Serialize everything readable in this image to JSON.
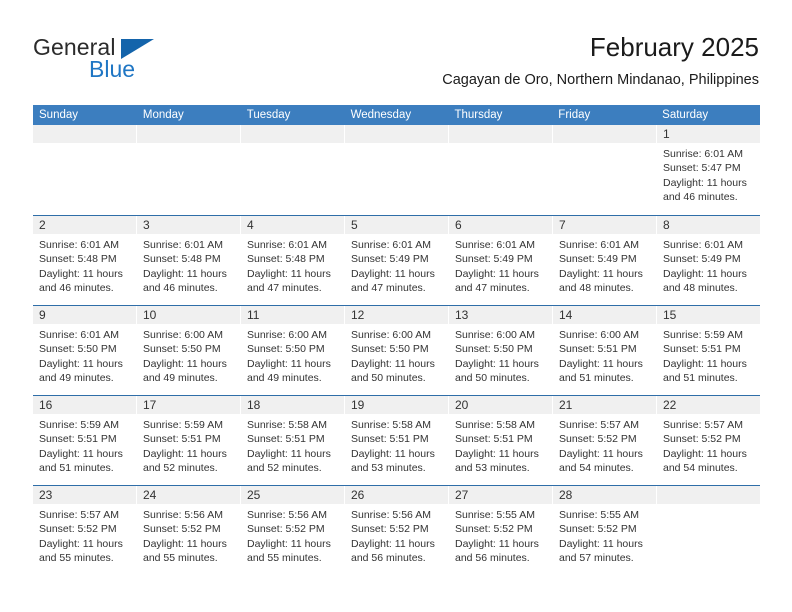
{
  "brand": {
    "name_part1": "General",
    "name_part2": "Blue",
    "accent_color": "#1f76c4",
    "triangle_color": "#1464ab"
  },
  "header": {
    "title": "February 2025",
    "subtitle": "Cagayan de Oro, Northern Mindanao, Philippines"
  },
  "calendar": {
    "header_bg": "#3c7ebf",
    "weekdays": [
      "Sunday",
      "Monday",
      "Tuesday",
      "Wednesday",
      "Thursday",
      "Friday",
      "Saturday"
    ],
    "weeks": [
      [
        {
          "date": "",
          "sunrise": "",
          "sunset": "",
          "daylight_line1": "",
          "daylight_line2": ""
        },
        {
          "date": "",
          "sunrise": "",
          "sunset": "",
          "daylight_line1": "",
          "daylight_line2": ""
        },
        {
          "date": "",
          "sunrise": "",
          "sunset": "",
          "daylight_line1": "",
          "daylight_line2": ""
        },
        {
          "date": "",
          "sunrise": "",
          "sunset": "",
          "daylight_line1": "",
          "daylight_line2": ""
        },
        {
          "date": "",
          "sunrise": "",
          "sunset": "",
          "daylight_line1": "",
          "daylight_line2": ""
        },
        {
          "date": "",
          "sunrise": "",
          "sunset": "",
          "daylight_line1": "",
          "daylight_line2": ""
        },
        {
          "date": "1",
          "sunrise": "Sunrise: 6:01 AM",
          "sunset": "Sunset: 5:47 PM",
          "daylight_line1": "Daylight: 11 hours",
          "daylight_line2": "and 46 minutes."
        }
      ],
      [
        {
          "date": "2",
          "sunrise": "Sunrise: 6:01 AM",
          "sunset": "Sunset: 5:48 PM",
          "daylight_line1": "Daylight: 11 hours",
          "daylight_line2": "and 46 minutes."
        },
        {
          "date": "3",
          "sunrise": "Sunrise: 6:01 AM",
          "sunset": "Sunset: 5:48 PM",
          "daylight_line1": "Daylight: 11 hours",
          "daylight_line2": "and 46 minutes."
        },
        {
          "date": "4",
          "sunrise": "Sunrise: 6:01 AM",
          "sunset": "Sunset: 5:48 PM",
          "daylight_line1": "Daylight: 11 hours",
          "daylight_line2": "and 47 minutes."
        },
        {
          "date": "5",
          "sunrise": "Sunrise: 6:01 AM",
          "sunset": "Sunset: 5:49 PM",
          "daylight_line1": "Daylight: 11 hours",
          "daylight_line2": "and 47 minutes."
        },
        {
          "date": "6",
          "sunrise": "Sunrise: 6:01 AM",
          "sunset": "Sunset: 5:49 PM",
          "daylight_line1": "Daylight: 11 hours",
          "daylight_line2": "and 47 minutes."
        },
        {
          "date": "7",
          "sunrise": "Sunrise: 6:01 AM",
          "sunset": "Sunset: 5:49 PM",
          "daylight_line1": "Daylight: 11 hours",
          "daylight_line2": "and 48 minutes."
        },
        {
          "date": "8",
          "sunrise": "Sunrise: 6:01 AM",
          "sunset": "Sunset: 5:49 PM",
          "daylight_line1": "Daylight: 11 hours",
          "daylight_line2": "and 48 minutes."
        }
      ],
      [
        {
          "date": "9",
          "sunrise": "Sunrise: 6:01 AM",
          "sunset": "Sunset: 5:50 PM",
          "daylight_line1": "Daylight: 11 hours",
          "daylight_line2": "and 49 minutes."
        },
        {
          "date": "10",
          "sunrise": "Sunrise: 6:00 AM",
          "sunset": "Sunset: 5:50 PM",
          "daylight_line1": "Daylight: 11 hours",
          "daylight_line2": "and 49 minutes."
        },
        {
          "date": "11",
          "sunrise": "Sunrise: 6:00 AM",
          "sunset": "Sunset: 5:50 PM",
          "daylight_line1": "Daylight: 11 hours",
          "daylight_line2": "and 49 minutes."
        },
        {
          "date": "12",
          "sunrise": "Sunrise: 6:00 AM",
          "sunset": "Sunset: 5:50 PM",
          "daylight_line1": "Daylight: 11 hours",
          "daylight_line2": "and 50 minutes."
        },
        {
          "date": "13",
          "sunrise": "Sunrise: 6:00 AM",
          "sunset": "Sunset: 5:50 PM",
          "daylight_line1": "Daylight: 11 hours",
          "daylight_line2": "and 50 minutes."
        },
        {
          "date": "14",
          "sunrise": "Sunrise: 6:00 AM",
          "sunset": "Sunset: 5:51 PM",
          "daylight_line1": "Daylight: 11 hours",
          "daylight_line2": "and 51 minutes."
        },
        {
          "date": "15",
          "sunrise": "Sunrise: 5:59 AM",
          "sunset": "Sunset: 5:51 PM",
          "daylight_line1": "Daylight: 11 hours",
          "daylight_line2": "and 51 minutes."
        }
      ],
      [
        {
          "date": "16",
          "sunrise": "Sunrise: 5:59 AM",
          "sunset": "Sunset: 5:51 PM",
          "daylight_line1": "Daylight: 11 hours",
          "daylight_line2": "and 51 minutes."
        },
        {
          "date": "17",
          "sunrise": "Sunrise: 5:59 AM",
          "sunset": "Sunset: 5:51 PM",
          "daylight_line1": "Daylight: 11 hours",
          "daylight_line2": "and 52 minutes."
        },
        {
          "date": "18",
          "sunrise": "Sunrise: 5:58 AM",
          "sunset": "Sunset: 5:51 PM",
          "daylight_line1": "Daylight: 11 hours",
          "daylight_line2": "and 52 minutes."
        },
        {
          "date": "19",
          "sunrise": "Sunrise: 5:58 AM",
          "sunset": "Sunset: 5:51 PM",
          "daylight_line1": "Daylight: 11 hours",
          "daylight_line2": "and 53 minutes."
        },
        {
          "date": "20",
          "sunrise": "Sunrise: 5:58 AM",
          "sunset": "Sunset: 5:51 PM",
          "daylight_line1": "Daylight: 11 hours",
          "daylight_line2": "and 53 minutes."
        },
        {
          "date": "21",
          "sunrise": "Sunrise: 5:57 AM",
          "sunset": "Sunset: 5:52 PM",
          "daylight_line1": "Daylight: 11 hours",
          "daylight_line2": "and 54 minutes."
        },
        {
          "date": "22",
          "sunrise": "Sunrise: 5:57 AM",
          "sunset": "Sunset: 5:52 PM",
          "daylight_line1": "Daylight: 11 hours",
          "daylight_line2": "and 54 minutes."
        }
      ],
      [
        {
          "date": "23",
          "sunrise": "Sunrise: 5:57 AM",
          "sunset": "Sunset: 5:52 PM",
          "daylight_line1": "Daylight: 11 hours",
          "daylight_line2": "and 55 minutes."
        },
        {
          "date": "24",
          "sunrise": "Sunrise: 5:56 AM",
          "sunset": "Sunset: 5:52 PM",
          "daylight_line1": "Daylight: 11 hours",
          "daylight_line2": "and 55 minutes."
        },
        {
          "date": "25",
          "sunrise": "Sunrise: 5:56 AM",
          "sunset": "Sunset: 5:52 PM",
          "daylight_line1": "Daylight: 11 hours",
          "daylight_line2": "and 55 minutes."
        },
        {
          "date": "26",
          "sunrise": "Sunrise: 5:56 AM",
          "sunset": "Sunset: 5:52 PM",
          "daylight_line1": "Daylight: 11 hours",
          "daylight_line2": "and 56 minutes."
        },
        {
          "date": "27",
          "sunrise": "Sunrise: 5:55 AM",
          "sunset": "Sunset: 5:52 PM",
          "daylight_line1": "Daylight: 11 hours",
          "daylight_line2": "and 56 minutes."
        },
        {
          "date": "28",
          "sunrise": "Sunrise: 5:55 AM",
          "sunset": "Sunset: 5:52 PM",
          "daylight_line1": "Daylight: 11 hours",
          "daylight_line2": "and 57 minutes."
        },
        {
          "date": "",
          "sunrise": "",
          "sunset": "",
          "daylight_line1": "",
          "daylight_line2": ""
        }
      ]
    ]
  }
}
